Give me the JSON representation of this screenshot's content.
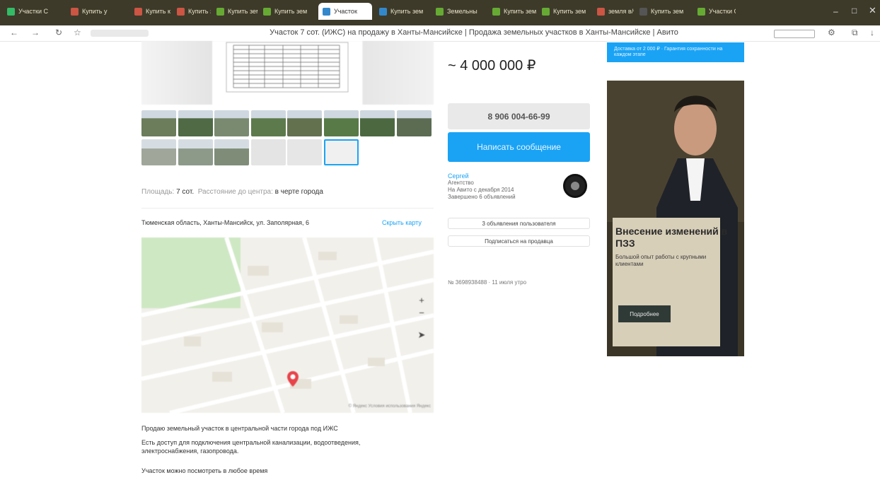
{
  "browser": {
    "tabs": [
      {
        "label": "Участки С"
      },
      {
        "label": "Купить у"
      },
      {
        "label": "Купить к"
      },
      {
        "label": "Купить зем"
      },
      {
        "label": "Купить зем"
      },
      {
        "label": "Купить зем"
      },
      {
        "label": "Участок"
      },
      {
        "label": "Купить зем"
      },
      {
        "label": "Земельны"
      },
      {
        "label": "Купить зем"
      },
      {
        "label": "Купить зем"
      },
      {
        "label": "земля в/ч"
      },
      {
        "label": "Купить зем"
      },
      {
        "label": "Участки С"
      }
    ],
    "address_title": "Участок 7 сот. (ИЖС) на продажу в Ханты-Мансийске | Продажа земельных участков в Ханты-Мансийске | Авито"
  },
  "listing": {
    "price": "~ 4 000 000 ₽",
    "phone_button": "8 906 004-66-99",
    "message_button": "Написать сообщение",
    "seller_name": "Сергей",
    "seller_role": "Агентство",
    "seller_since": "На Авито с декабря 2014",
    "seller_ads": "Завершено 6 объявлений",
    "btn_all_ads": "3 объявления пользователя",
    "btn_subscribe": "Подписаться на продавца",
    "ad_number": "№ 3698938488 · 11 июля утро",
    "area_label": "Площадь:",
    "area_value": "7 сот.",
    "distance_label": "Расстояние до центра:",
    "distance_value": "в черте города",
    "address": "Тюменская область, Ханты-Мансийск, ул. Заполярная, 6",
    "show_map": "Скрыть карту",
    "map_copyright": "© Яндекс Условия использования Яндекс",
    "description": [
      "Продаю земельный участок в центральной части города под ИЖС",
      "Есть доступ для подключения центральной канализации, водоотведения, электроснабжения, газопровода.",
      "Участок можно посмотреть в любое время"
    ]
  },
  "sidebar_ad": {
    "top_banner": "Доставка от 2 000 ₽ · Гарантия сохранности на каждом этапе",
    "title": "Внесение изменений в ПЗЗ",
    "subtitle": "Большой опыт работы с крупными клиентами",
    "button": "Подробнее"
  },
  "colors": {
    "accent": "#1aa3f5",
    "tabbar": "#3d3a2a"
  }
}
